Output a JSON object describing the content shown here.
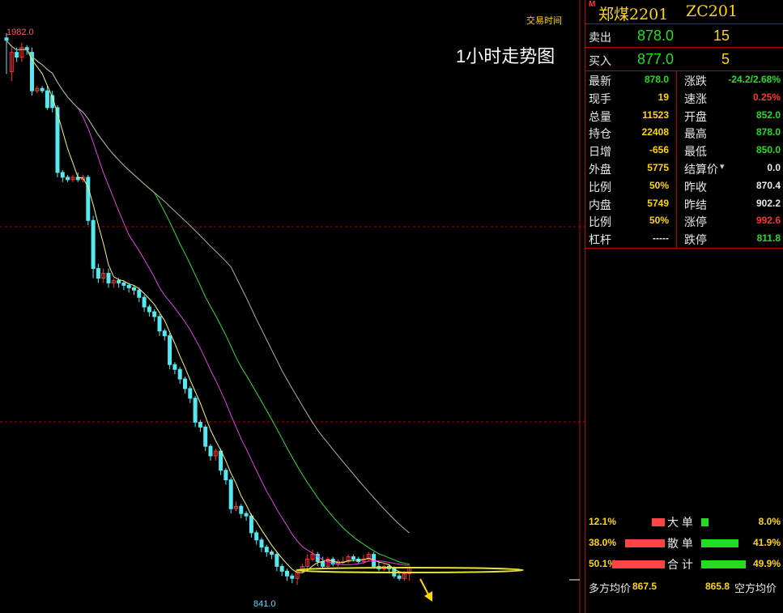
{
  "chart": {
    "top_label": "交易时间",
    "title": "1小时走势图",
    "high_label": "1982.0",
    "low_label": "841.0",
    "candles": [
      [
        1980,
        1975,
        1905,
        1990
      ],
      [
        1910,
        1950,
        1890,
        1960
      ],
      [
        1950,
        1940,
        1930,
        1960
      ],
      [
        1940,
        1960,
        1930,
        1970
      ],
      [
        1960,
        1955,
        1945,
        1965
      ],
      [
        1950,
        1870,
        1860,
        1960
      ],
      [
        1870,
        1875,
        1865,
        1880
      ],
      [
        1875,
        1870,
        1865,
        1880
      ],
      [
        1870,
        1835,
        1830,
        1880
      ],
      [
        1860,
        1835,
        1825,
        1870
      ],
      [
        1835,
        1700,
        1690,
        1840
      ],
      [
        1700,
        1690,
        1680,
        1705
      ],
      [
        1690,
        1685,
        1680,
        1695
      ],
      [
        1685,
        1690,
        1680,
        1695
      ],
      [
        1690,
        1685,
        1680,
        1700
      ],
      [
        1685,
        1690,
        1680,
        1695
      ],
      [
        1690,
        1600,
        1590,
        1695
      ],
      [
        1600,
        1500,
        1480,
        1610
      ],
      [
        1500,
        1480,
        1470,
        1510
      ],
      [
        1480,
        1490,
        1470,
        1500
      ],
      [
        1490,
        1470,
        1460,
        1500
      ],
      [
        1470,
        1475,
        1460,
        1480
      ],
      [
        1475,
        1470,
        1460,
        1480
      ],
      [
        1470,
        1465,
        1455,
        1475
      ],
      [
        1465,
        1460,
        1450,
        1470
      ],
      [
        1460,
        1455,
        1445,
        1465
      ],
      [
        1455,
        1440,
        1430,
        1460
      ],
      [
        1440,
        1420,
        1410,
        1445
      ],
      [
        1420,
        1410,
        1400,
        1425
      ],
      [
        1410,
        1400,
        1390,
        1415
      ],
      [
        1400,
        1370,
        1360,
        1405
      ],
      [
        1370,
        1360,
        1350,
        1375
      ],
      [
        1360,
        1300,
        1290,
        1365
      ],
      [
        1300,
        1290,
        1280,
        1305
      ],
      [
        1290,
        1270,
        1260,
        1295
      ],
      [
        1270,
        1250,
        1240,
        1275
      ],
      [
        1250,
        1230,
        1220,
        1255
      ],
      [
        1230,
        1180,
        1170,
        1235
      ],
      [
        1180,
        1170,
        1160,
        1185
      ],
      [
        1170,
        1130,
        1120,
        1175
      ],
      [
        1130,
        1110,
        1100,
        1135
      ],
      [
        1110,
        1120,
        1100,
        1125
      ],
      [
        1120,
        1080,
        1070,
        1125
      ],
      [
        1080,
        1060,
        1050,
        1085
      ],
      [
        1060,
        1000,
        990,
        1065
      ],
      [
        1000,
        1005,
        995,
        1015
      ],
      [
        1005,
        990,
        980,
        1010
      ],
      [
        990,
        985,
        975,
        995
      ],
      [
        985,
        950,
        940,
        990
      ],
      [
        950,
        935,
        925,
        955
      ],
      [
        935,
        920,
        910,
        940
      ],
      [
        920,
        910,
        900,
        925
      ],
      [
        910,
        905,
        895,
        915
      ],
      [
        905,
        880,
        870,
        910
      ],
      [
        880,
        870,
        860,
        885
      ],
      [
        870,
        860,
        850,
        875
      ],
      [
        860,
        855,
        845,
        865
      ],
      [
        855,
        870,
        841,
        875
      ],
      [
        870,
        880,
        865,
        885
      ],
      [
        880,
        895,
        875,
        905
      ],
      [
        895,
        905,
        890,
        915
      ],
      [
        905,
        890,
        880,
        910
      ],
      [
        890,
        880,
        875,
        900
      ],
      [
        880,
        895,
        875,
        900
      ],
      [
        895,
        885,
        880,
        900
      ],
      [
        885,
        890,
        880,
        895
      ],
      [
        890,
        890,
        885,
        900
      ],
      [
        890,
        900,
        885,
        905
      ],
      [
        900,
        895,
        890,
        905
      ],
      [
        895,
        890,
        885,
        900
      ],
      [
        890,
        895,
        885,
        905
      ],
      [
        895,
        905,
        890,
        910
      ],
      [
        905,
        880,
        875,
        910
      ],
      [
        880,
        875,
        870,
        890
      ],
      [
        875,
        880,
        870,
        885
      ],
      [
        880,
        875,
        865,
        885
      ],
      [
        875,
        860,
        855,
        880
      ],
      [
        860,
        855,
        850,
        865
      ],
      [
        855,
        865,
        850,
        870
      ],
      [
        865,
        878,
        850,
        880
      ]
    ]
  },
  "quote": {
    "header_name": "郑煤2201",
    "header_code": "ZC201",
    "ask_label": "卖出",
    "ask_price": "878.0",
    "ask_vol": "15",
    "bid_label": "买入",
    "bid_price": "877.0",
    "bid_vol": "5",
    "rows": [
      {
        "l1": "最新",
        "v1": "878.0",
        "c1": "green",
        "l2": "涨跌",
        "v2": "-24.2/2.68%",
        "c2": "green"
      },
      {
        "l1": "现手",
        "v1": "19",
        "c1": "yellow",
        "l2": "速涨",
        "v2": "0.25%",
        "c2": "red"
      },
      {
        "l1": "总量",
        "v1": "11523",
        "c1": "yellow",
        "l2": "开盘",
        "v2": "852.0",
        "c2": "green"
      },
      {
        "l1": "持仓",
        "v1": "22408",
        "c1": "yellow",
        "l2": "最高",
        "v2": "878.0",
        "c2": "green"
      },
      {
        "l1": "日增",
        "v1": "-656",
        "c1": "yellow",
        "l2": "最低",
        "v2": "850.0",
        "c2": "green"
      },
      {
        "l1": "外盘",
        "v1": "5775",
        "c1": "yellow",
        "l2": "结算价",
        "v2": "0.0",
        "c2": "white"
      },
      {
        "l1": "比例",
        "v1": "50%",
        "c1": "yellow",
        "l2": "昨收",
        "v2": "870.4",
        "c2": "white"
      },
      {
        "l1": "内盘",
        "v1": "5749",
        "c1": "yellow",
        "l2": "昨结",
        "v2": "902.2",
        "c2": "white"
      },
      {
        "l1": "比例",
        "v1": "50%",
        "c1": "yellow",
        "l2": "涨停",
        "v2": "992.6",
        "c2": "red"
      },
      {
        "l1": "杠杆",
        "v1": "-----",
        "c1": "white",
        "l2": "跌停",
        "v2": "811.8",
        "c2": "green"
      }
    ],
    "flow": [
      {
        "left_pct": "12.1%",
        "label": "大 单",
        "right_pct": "8.0%",
        "red": 0.121,
        "green": 0.08
      },
      {
        "left_pct": "38.0%",
        "label": "散 单",
        "right_pct": "41.9%",
        "red": 0.38,
        "green": 0.419
      },
      {
        "left_pct": "50.1%",
        "label": "合 计",
        "right_pct": "49.9%",
        "red": 0.501,
        "green": 0.499
      }
    ],
    "long_avg_label": "多方均价",
    "long_avg": "867.5",
    "short_avg": "865.8",
    "short_avg_label": "空方均价"
  }
}
